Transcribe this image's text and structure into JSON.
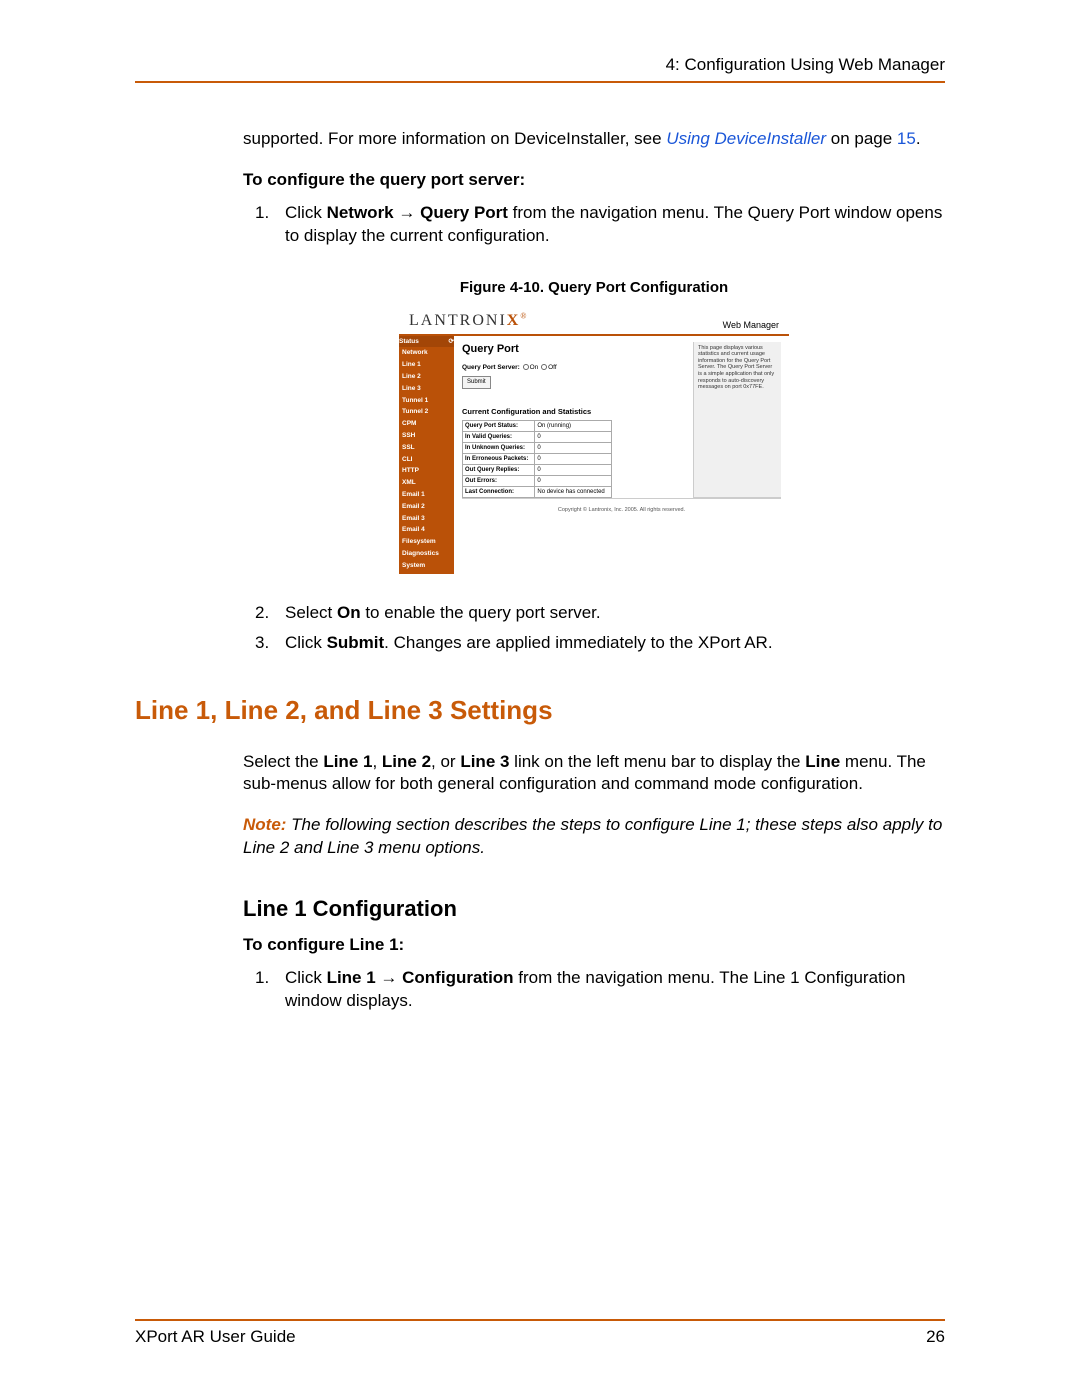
{
  "header": {
    "chapter": "4: Configuration Using Web Manager"
  },
  "intro": {
    "pre": "supported.  For more information on DeviceInstaller, see ",
    "link": "Using DeviceInstaller",
    "post": " on page ",
    "pagenum": "15",
    "tail": "."
  },
  "sub1": "To configure the query port server:",
  "step1": {
    "num": "1.",
    "pre": "Click ",
    "b1": "Network",
    "arrow": " → ",
    "b2": "Query Port",
    "post": " from the navigation menu. The Query Port window opens to display the current configuration."
  },
  "figcap": "Figure 4-10. Query Port Configuration",
  "screenshot": {
    "logo_l": "LANTRONI",
    "logo_x": "X",
    "webmanager": "Web Manager",
    "nav": [
      "Status",
      "Network",
      "Line 1",
      "Line 2",
      "Line 3",
      "Tunnel 1",
      "Tunnel 2",
      "CPM",
      "SSH",
      "SSL",
      "CLI",
      "HTTP",
      "XML",
      "Email 1",
      "Email 2",
      "Email 3",
      "Email 4",
      "Filesystem",
      "Diagnostics",
      "System"
    ],
    "nav_icon": "⟳",
    "qp_title": "Query Port",
    "qp_server_label": "Query Port Server:",
    "qp_on": "On",
    "qp_off": "Off",
    "qp_submit": "Submit",
    "qp_section": "Current Configuration and Statistics",
    "stats": [
      [
        "Query Port Status:",
        "On (running)"
      ],
      [
        "In Valid Queries:",
        "0"
      ],
      [
        "In Unknown Queries:",
        "0"
      ],
      [
        "In Erroneous Packets:",
        "0"
      ],
      [
        "Out Query Replies:",
        "0"
      ],
      [
        "Out Errors:",
        "0"
      ],
      [
        "Last Connection:",
        "No device has connected"
      ]
    ],
    "help": "This page displays various statistics and current usage information for the Query Port Server. The Query Port Server is a simple application that only responds to auto-discovery messages on port 0x77FE.",
    "copyright": "Copyright © Lantronix, Inc. 2005. All rights reserved."
  },
  "step2": {
    "num": "2.",
    "pre": "Select ",
    "b": "On",
    "post": " to enable the query port server."
  },
  "step3": {
    "num": "3.",
    "pre": "Click ",
    "b": "Submit",
    "post": ". Changes are applied immediately to the XPort AR."
  },
  "h1": "Line 1, Line 2, and Line 3 Settings",
  "linepara": {
    "pre": "Select the ",
    "b1": "Line 1",
    "c1": ", ",
    "b2": "Line 2",
    "c2": ", or ",
    "b3": "Line 3",
    "c3": " link on the left menu bar to display the ",
    "b4": "Line",
    "post": " menu.  The sub-menus allow for both general configuration and command mode configuration."
  },
  "note": {
    "label": "Note:",
    "body": " The following section describes the steps to configure Line 1; these steps also apply to Line 2 and Line 3 menu options."
  },
  "h2": "Line 1 Configuration",
  "sub2": "To configure Line 1:",
  "cfg1": {
    "num": "1.",
    "pre": "Click ",
    "b1": "Line 1",
    "arrow": " → ",
    "b2": "Configuration",
    "post": " from the navigation menu. The Line 1 Configuration window displays."
  },
  "footer": {
    "left": "XPort AR User Guide",
    "right": "26"
  }
}
